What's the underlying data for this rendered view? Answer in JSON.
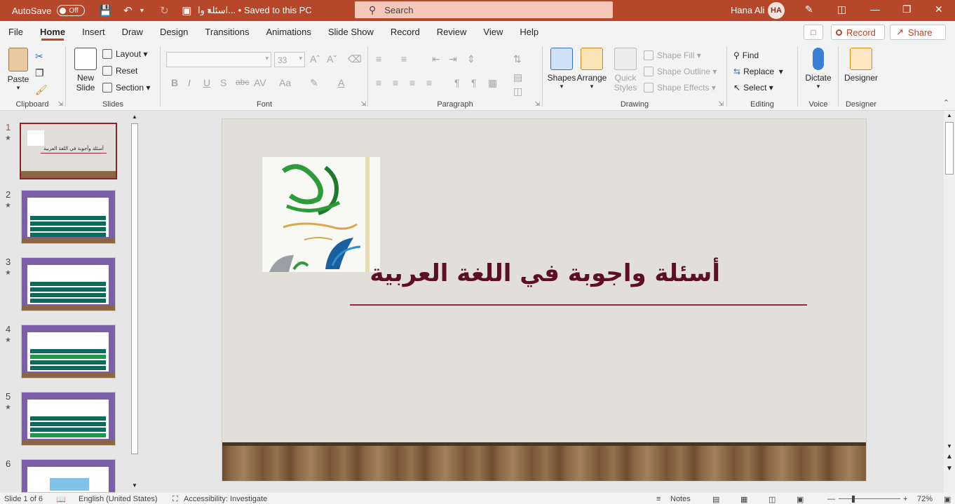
{
  "titlebar": {
    "autosave_label": "AutoSave",
    "autosave_state": "Off",
    "doc_title": "اسئله وا... • Saved to this PC",
    "search_placeholder": "Search",
    "user_name": "Hana Ali",
    "user_initials": "HA",
    "accent": "#b7472a"
  },
  "menu": {
    "items": [
      "File",
      "Home",
      "Insert",
      "Draw",
      "Design",
      "Transitions",
      "Animations",
      "Slide Show",
      "Record",
      "Review",
      "View",
      "Help"
    ],
    "active": "Home",
    "record_label": "Record",
    "share_label": "Share"
  },
  "ribbon": {
    "clipboard": {
      "label": "Clipboard",
      "paste": "Paste"
    },
    "slides": {
      "label": "Slides",
      "new_slide_1": "New",
      "new_slide_2": "Slide",
      "layout": "Layout",
      "reset": "Reset",
      "section": "Section"
    },
    "font": {
      "label": "Font",
      "size": "33"
    },
    "paragraph": {
      "label": "Paragraph"
    },
    "drawing": {
      "label": "Drawing",
      "shapes": "Shapes",
      "arrange": "Arrange",
      "quick_1": "Quick",
      "quick_2": "Styles",
      "shape_fill": "Shape Fill",
      "shape_outline": "Shape Outline",
      "shape_effects": "Shape Effects"
    },
    "editing": {
      "label": "Editing",
      "find": "Find",
      "replace": "Replace",
      "select": "Select"
    },
    "voice": {
      "label": "Voice",
      "dictate": "Dictate"
    },
    "designer": {
      "label": "Designer",
      "designer": "Designer"
    }
  },
  "thumbnails": {
    "items": [
      {
        "num": "1",
        "caption": "أسئلة وأجوبة في اللغة العربية"
      },
      {
        "num": "2"
      },
      {
        "num": "3"
      },
      {
        "num": "4"
      },
      {
        "num": "5"
      },
      {
        "num": "6"
      }
    ],
    "selected": "1"
  },
  "slide": {
    "title": "أسئلة واجوبة في اللغة العربية",
    "title_color": "#5c1020"
  },
  "status": {
    "slide_info": "Slide 1 of 6",
    "language": "English (United States)",
    "accessibility": "Accessibility: Investigate",
    "notes": "Notes",
    "zoom": "72%"
  }
}
